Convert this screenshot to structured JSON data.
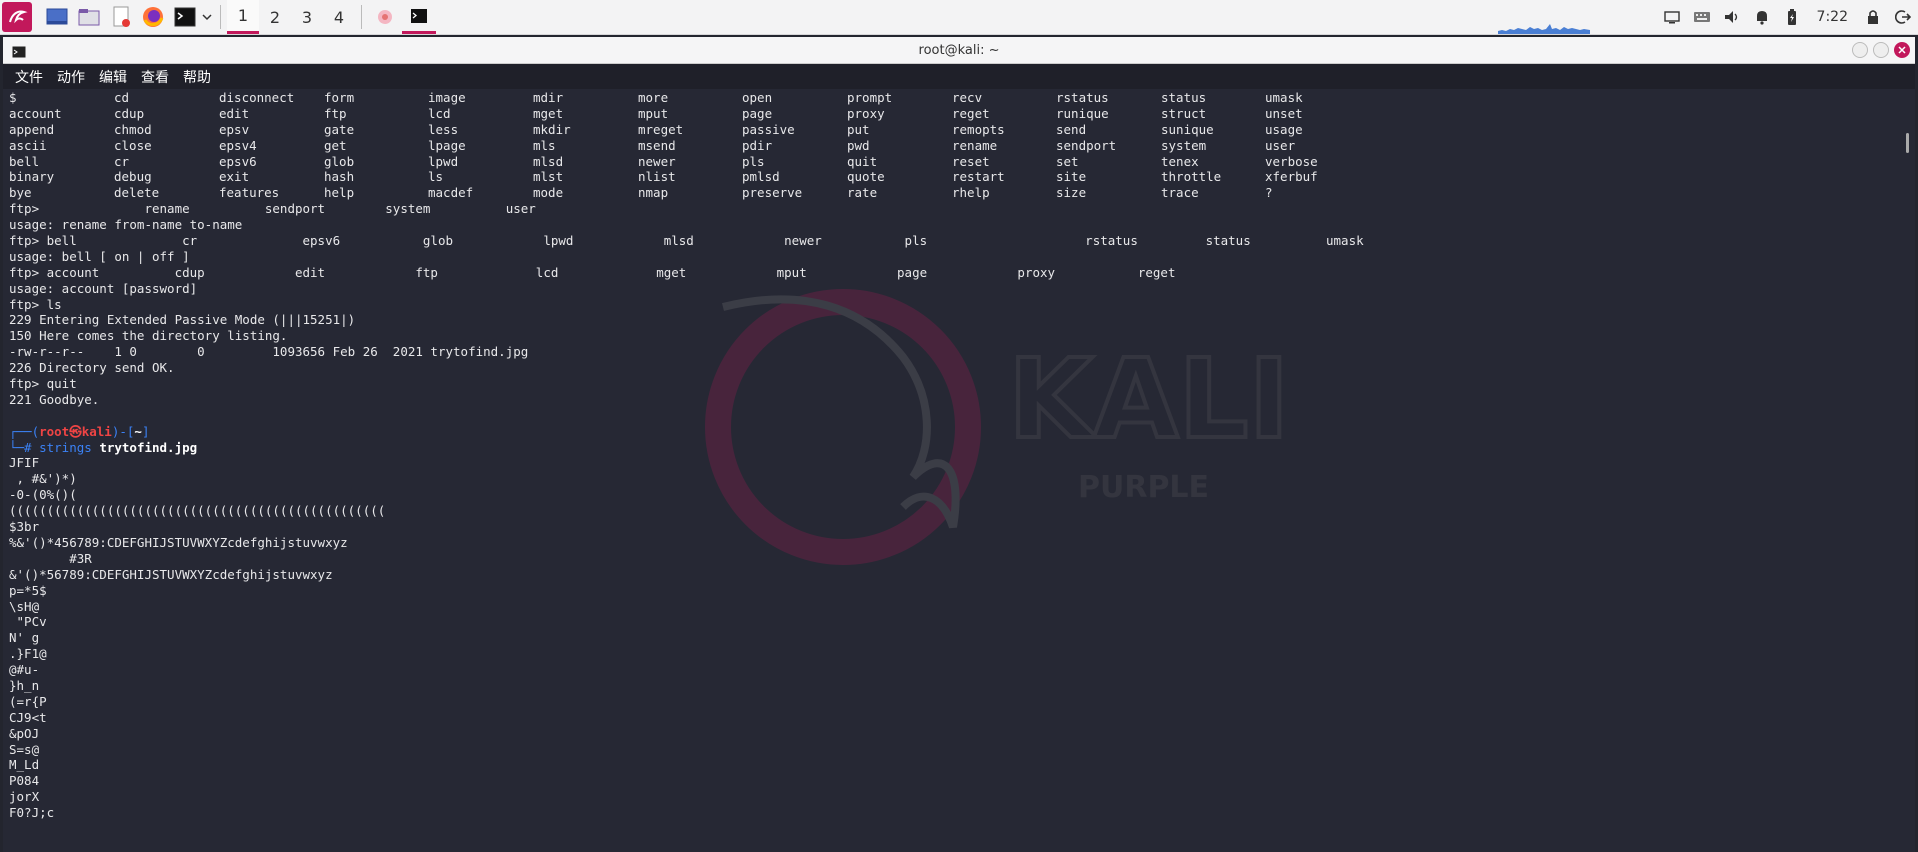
{
  "taskbar": {
    "workspaces": [
      "1",
      "2",
      "3",
      "4"
    ],
    "clock": "7:22"
  },
  "window": {
    "title": "root@kali: ~"
  },
  "menubar": [
    "文件",
    "动作",
    "编辑",
    "查看",
    "帮助"
  ],
  "watermark": {
    "line1": "KALI",
    "line2": "PURPLE"
  },
  "terminal": {
    "cmd_grid": [
      [
        "$",
        "cd",
        "disconnect",
        "form",
        "image",
        "mdir",
        "more",
        "open",
        "prompt",
        "recv",
        "rstatus",
        "status",
        "umask"
      ],
      [
        "account",
        "cdup",
        "edit",
        "ftp",
        "lcd",
        "mget",
        "mput",
        "page",
        "proxy",
        "reget",
        "runique",
        "struct",
        "unset"
      ],
      [
        "append",
        "chmod",
        "epsv",
        "gate",
        "less",
        "mkdir",
        "mreget",
        "passive",
        "put",
        "remopts",
        "send",
        "sunique",
        "usage"
      ],
      [
        "ascii",
        "close",
        "epsv4",
        "get",
        "lpage",
        "mls",
        "msend",
        "pdir",
        "pwd",
        "rename",
        "sendport",
        "system",
        "user"
      ],
      [
        "bell",
        "cr",
        "epsv6",
        "glob",
        "lpwd",
        "mlsd",
        "newer",
        "pls",
        "quit",
        "reset",
        "set",
        "tenex",
        "verbose"
      ],
      [
        "binary",
        "debug",
        "exit",
        "hash",
        "ls",
        "mlst",
        "nlist",
        "pmlsd",
        "quote",
        "restart",
        "site",
        "throttle",
        "xferbuf"
      ],
      [
        "bye",
        "delete",
        "features",
        "help",
        "macdef",
        "mode",
        "nmap",
        "preserve",
        "rate",
        "rhelp",
        "size",
        "trace",
        "?"
      ]
    ],
    "lines": [
      "ftp>              rename          sendport        system          user",
      "usage: rename from-name to-name",
      "ftp> bell              cr              epsv6           glob            lpwd            mlsd            newer           pls                     rstatus         status          umask",
      "usage: bell [ on | off ]",
      "ftp> account          cdup            edit            ftp             lcd             mget            mput            page            proxy           reget",
      "usage: account [password]",
      "ftp> ls",
      "229 Entering Extended Passive Mode (|||15251|)",
      "150 Here comes the directory listing.",
      "-rw-r--r--    1 0        0         1093656 Feb 26  2021 trytofind.jpg",
      "226 Directory send OK.",
      "ftp> quit",
      "221 Goodbye.",
      ""
    ],
    "prompt": {
      "open": "┌──(",
      "user": "root㉿kali",
      "mid": ")-[",
      "dir": "~",
      "close": "]",
      "hash": "└─#",
      "cmd": "strings",
      "arg": "trytofind.jpg"
    },
    "output": [
      "JFIF",
      " , #&')*)",
      "-0-(0%()(",
      "((((((((((((((((((((((((((((((((((((((((((((((((((",
      "$3br",
      "%&'()*456789:CDEFGHIJSTUVWXYZcdefghijstuvwxyz",
      "        #3R",
      "&'()*56789:CDEFGHIJSTUVWXYZcdefghijstuvwxyz",
      "p=*5$",
      "\\sH@",
      " \"PCv",
      "N' g",
      ".}F1@",
      "@#u-",
      "}h_n",
      "(=r{P",
      "CJ9<t",
      "&pOJ",
      "S=s@",
      "M_Ld",
      "P084",
      "jorX",
      "F0?J;c"
    ]
  }
}
